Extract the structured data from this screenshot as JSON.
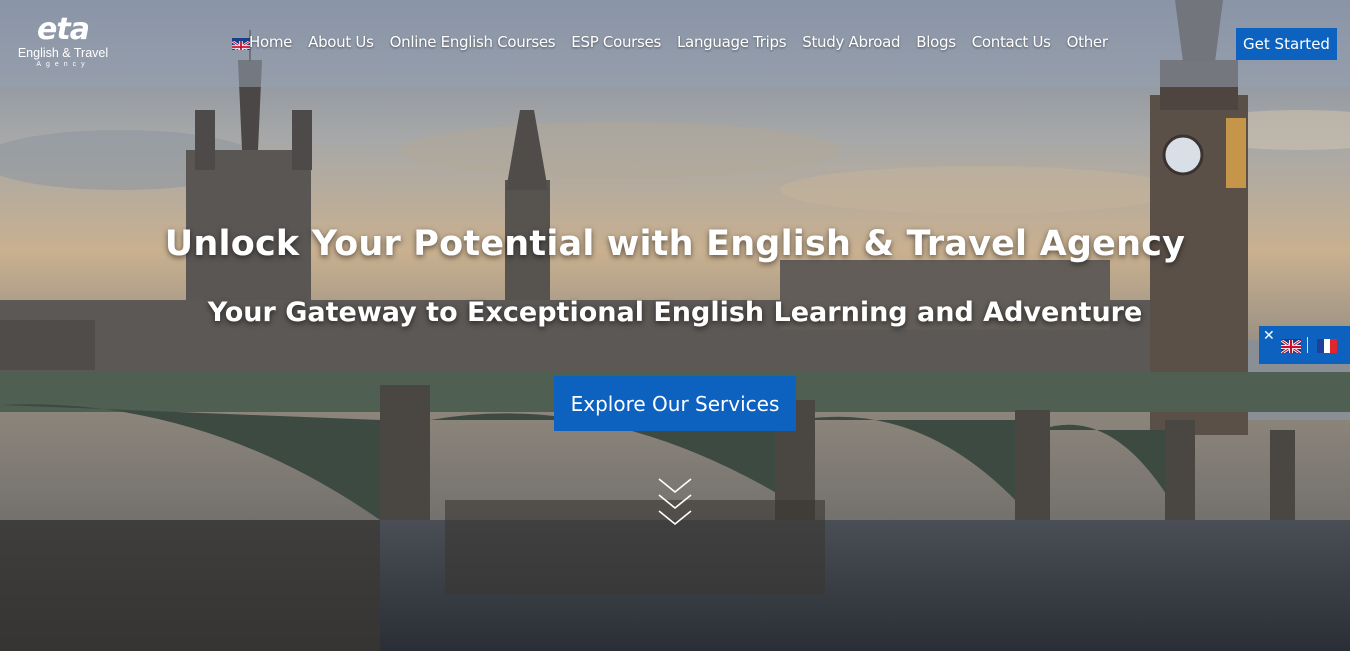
{
  "header": {
    "logo": {
      "mark": "eta",
      "name": "English & Travel",
      "sub": "Agency"
    },
    "nav": [
      {
        "label": "Home"
      },
      {
        "label": "About Us"
      },
      {
        "label": "Online English Courses"
      },
      {
        "label": "ESP Courses"
      },
      {
        "label": "Language Trips"
      },
      {
        "label": "Study Abroad"
      },
      {
        "label": "Blogs"
      },
      {
        "label": "Contact Us"
      },
      {
        "label": "Other"
      }
    ],
    "cta_label": "Get Started"
  },
  "hero": {
    "headline": "Unlock Your Potential with English & Travel Agency",
    "subheadline": "Your Gateway to Exceptional English Learning and Adventure",
    "button_label": "Explore Our Services"
  },
  "language_switcher": {
    "close_symbol": "✕",
    "options": [
      "English",
      "French"
    ]
  },
  "colors": {
    "accent": "#0d62c0",
    "header_overlay": "rgba(150,160,178,0.55)",
    "text": "#ffffff"
  },
  "icons": [
    "scroll-down-chevrons-icon",
    "uk-flag-icon",
    "fr-flag-icon",
    "close-icon"
  ]
}
